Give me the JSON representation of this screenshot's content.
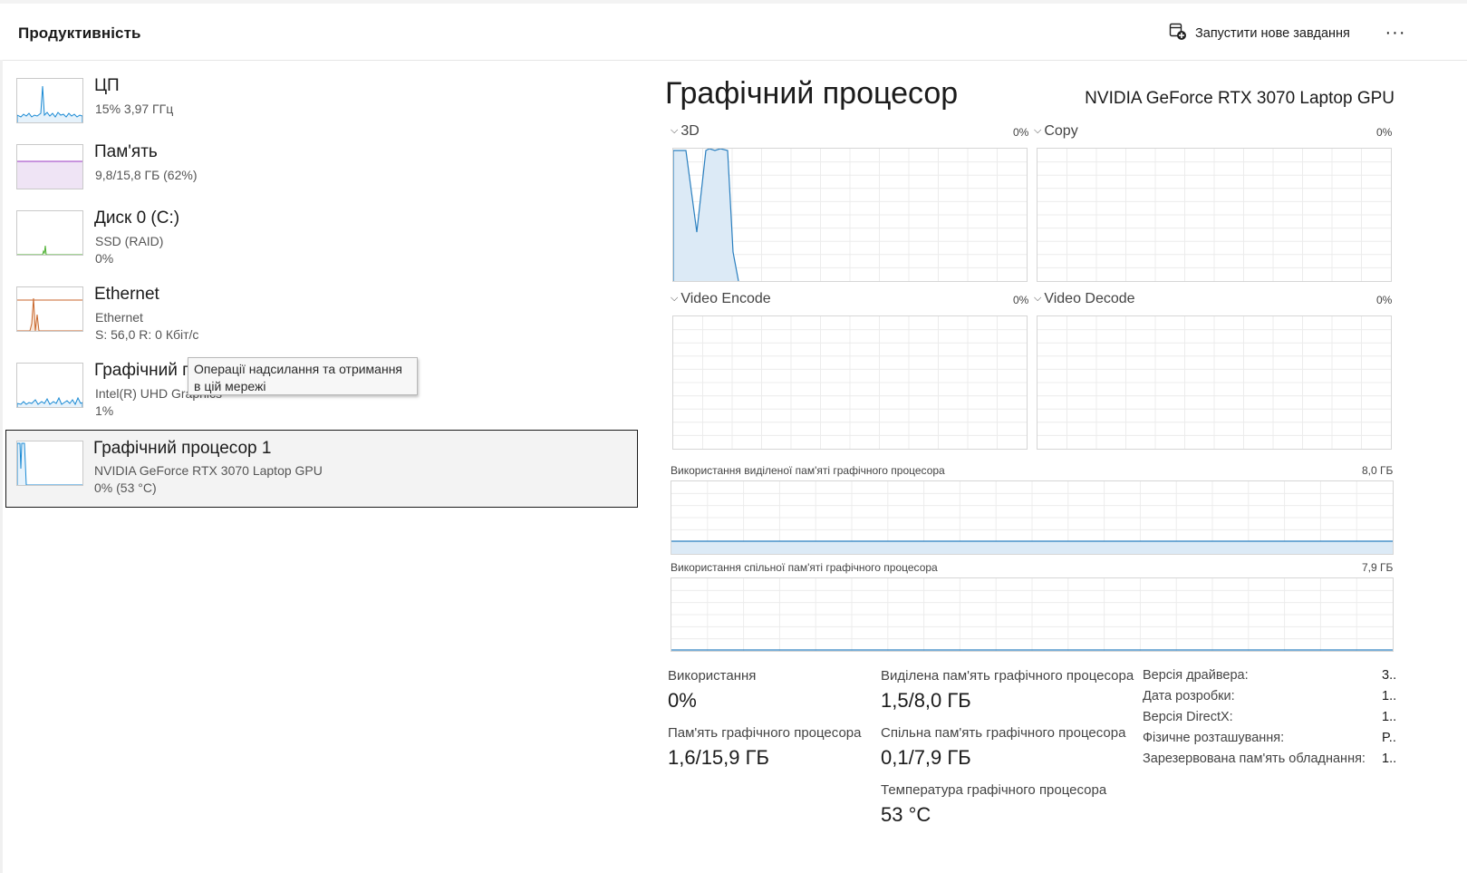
{
  "header": {
    "title": "Продуктивність",
    "new_task_label": "Запустити нове завдання",
    "more_label": "···"
  },
  "sidebar": [
    {
      "name": "ЦП",
      "sub1": "15%  3,97 ГГц",
      "sub2": "",
      "color": "#1a8ad4"
    },
    {
      "name": "Пам'ять",
      "sub1": "9,8/15,8 ГБ (62%)",
      "sub2": "",
      "color": "#9b3ac2"
    },
    {
      "name": "Диск 0 (C:)",
      "sub1": "SSD (RAID)",
      "sub2": "0%",
      "color": "#4caf30"
    },
    {
      "name": "Ethernet",
      "sub1": "Ethernet",
      "sub2": "S: 56,0  R: 0 Кбіт/с",
      "color": "#c8662b"
    },
    {
      "name": "Графічний процесор 0",
      "sub1": "Intel(R) UHD Graphics",
      "sub2": "1%",
      "color": "#1a8ad4"
    },
    {
      "name": "Графічний процесор 1",
      "sub1": "NVIDIA GeForce RTX 3070 Laptop GPU",
      "sub2": "0%  (53 °C)",
      "color": "#1a8ad4"
    }
  ],
  "tooltip": {
    "line1": "Операції надсилання та отримання",
    "line2": "в цій мережі"
  },
  "detail": {
    "title": "Графічний процесор",
    "model": "NVIDIA GeForce RTX 3070 Laptop GPU",
    "engines": [
      {
        "name": "3D",
        "pct": "0%"
      },
      {
        "name": "Copy",
        "pct": "0%"
      },
      {
        "name": "Video Encode",
        "pct": "0%"
      },
      {
        "name": "Video Decode",
        "pct": "0%"
      }
    ],
    "dedicated_mem": {
      "label": "Використання виділеної пам'яті графічного процесора",
      "max": "8,0 ГБ"
    },
    "shared_mem": {
      "label": "Використання спільної пам'яті графічного процесора",
      "max": "7,9 ГБ"
    },
    "stats": {
      "usage_label": "Використання",
      "usage_value": "0%",
      "gpu_mem_label": "Пам'ять графічного процесора",
      "gpu_mem_value": "1,6/15,9 ГБ",
      "dedicated_label": "Виділена пам'ять графічного процесора",
      "dedicated_value": "1,5/8,0 ГБ",
      "shared_label": "Спільна пам'ять графічного процесора",
      "shared_value": "0,1/7,9 ГБ",
      "temp_label": "Температура графічного процесора",
      "temp_value": "53 °C"
    },
    "info": [
      {
        "label": "Версія драйвера:",
        "value": "3.."
      },
      {
        "label": "Дата розробки:",
        "value": "1.."
      },
      {
        "label": "Версія DirectX:",
        "value": "1.."
      },
      {
        "label": "Фізичне розташування:",
        "value": "P.."
      },
      {
        "label": "Зарезервована пам'ять обладнання:",
        "value": "1.."
      }
    ]
  }
}
